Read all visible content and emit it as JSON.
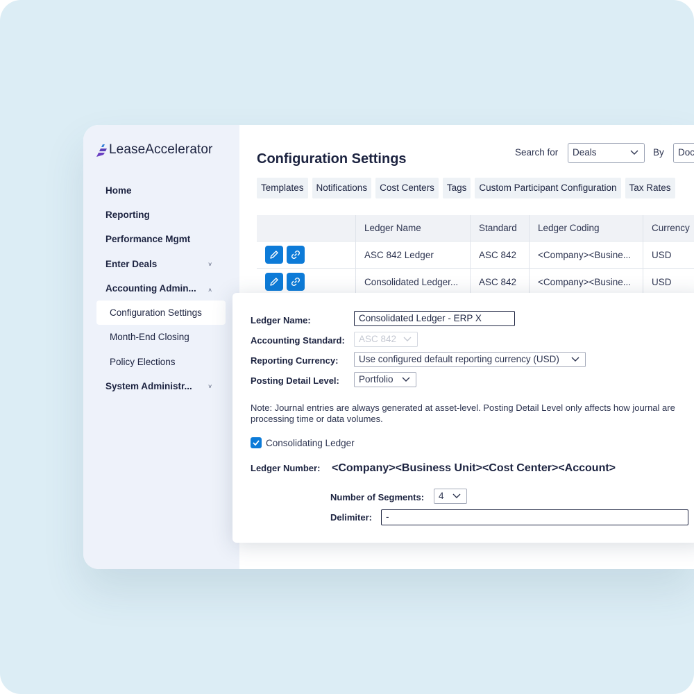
{
  "app": {
    "brand": "LeaseAccelerator"
  },
  "sidebar": {
    "items": [
      {
        "label": "Home"
      },
      {
        "label": "Reporting"
      },
      {
        "label": "Performance Mgmt"
      },
      {
        "label": "Enter Deals",
        "chevron": "˅"
      },
      {
        "label": "Accounting Admin...",
        "chevron": "˄"
      },
      {
        "label": "System Administr...",
        "chevron": "˅"
      }
    ],
    "subitems": [
      {
        "label": "Configuration Settings"
      },
      {
        "label": "Month-End Closing"
      },
      {
        "label": "Policy Elections"
      }
    ]
  },
  "header": {
    "title": "Configuration Settings",
    "search_label": "Search for",
    "search_value": "Deals",
    "by_label": "By",
    "by_value": "Doc"
  },
  "tabs": [
    {
      "label": "Templates"
    },
    {
      "label": "Notifications"
    },
    {
      "label": "Cost Centers"
    },
    {
      "label": "Tags"
    },
    {
      "label": "Custom Participant Configuration"
    },
    {
      "label": "Tax Rates"
    }
  ],
  "table": {
    "columns": [
      "Ledger Name",
      "Standard",
      "Ledger Coding",
      "Currency"
    ],
    "rows": [
      {
        "name": "ASC 842 Ledger",
        "standard": "ASC 842",
        "coding": "<Company><Busine...",
        "currency": "USD"
      },
      {
        "name": "Consolidated Ledger...",
        "standard": "ASC 842",
        "coding": "<Company><Busine...",
        "currency": "USD"
      }
    ]
  },
  "form": {
    "ledger_name_label": "Ledger Name:",
    "ledger_name_value": "Consolidated Ledger - ERP X",
    "standard_label": "Accounting Standard:",
    "standard_value": "ASC 842",
    "currency_label": "Reporting Currency:",
    "currency_value": "Use configured default reporting currency (USD)",
    "posting_label": "Posting Detail Level:",
    "posting_value": "Portfolio",
    "note_line1": "Note: Journal entries are always generated at asset-level. Posting Detail Level only affects how journal are",
    "note_line2": "processing time or data volumes.",
    "consolidating_label": "Consolidating Ledger",
    "consolidating_checked": true,
    "ledger_number_label": "Ledger Number:",
    "ledger_number_value": "<Company><Business Unit><Cost Center><Account>",
    "segments_label": "Number of Segments:",
    "segments_value": "4",
    "delimiter_label": "Delimiter:",
    "delimiter_value": "-"
  },
  "colors": {
    "accent": "#0d7bd8",
    "sidebar_bg": "#eef2fa",
    "page_bg": "#dcedf5"
  }
}
